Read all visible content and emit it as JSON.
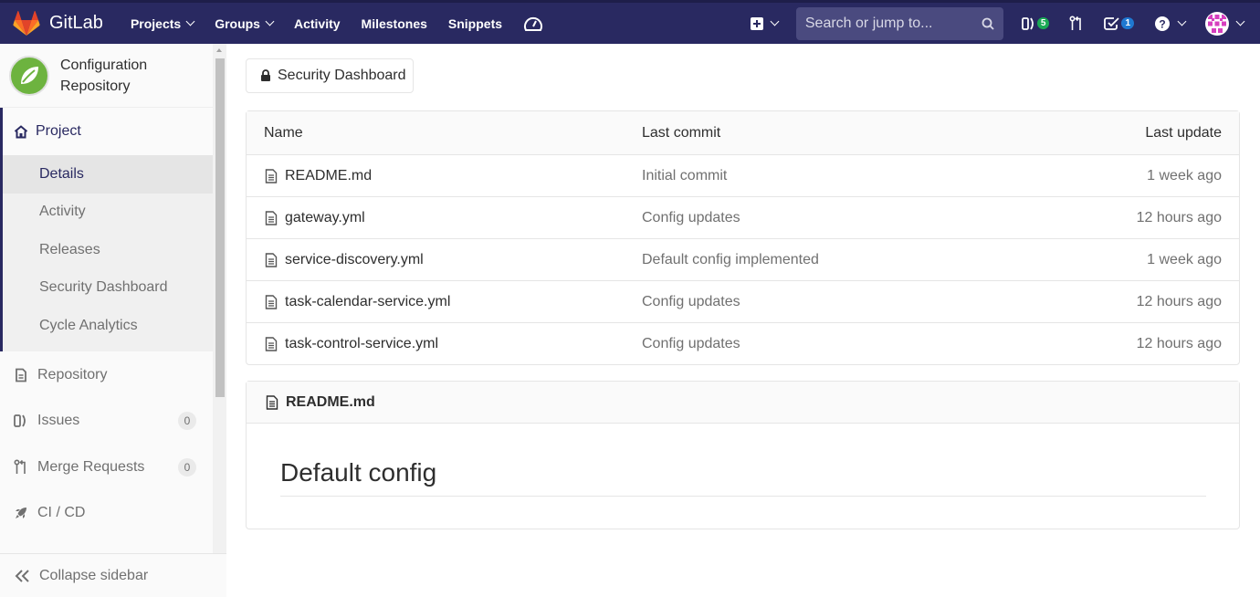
{
  "navbar": {
    "brand": "GitLab",
    "links": [
      "Projects",
      "Groups",
      "Activity",
      "Milestones",
      "Snippets"
    ],
    "search_placeholder": "Search or jump to...",
    "issues_count": "5",
    "todos_count": "1"
  },
  "sidebar": {
    "project_name": "Configuration Repository",
    "project_section": "Project",
    "project_items": [
      "Details",
      "Activity",
      "Releases",
      "Security Dashboard",
      "Cycle Analytics"
    ],
    "repository": "Repository",
    "issues": {
      "label": "Issues",
      "count": "0"
    },
    "merge_requests": {
      "label": "Merge Requests",
      "count": "0"
    },
    "cicd": "CI / CD",
    "collapse": "Collapse sidebar"
  },
  "main": {
    "security_button": "Security Dashboard",
    "table_headers": {
      "name": "Name",
      "last_commit": "Last commit",
      "last_update": "Last update"
    },
    "files": [
      {
        "name": "README.md",
        "commit": "Initial commit",
        "updated": "1 week ago"
      },
      {
        "name": "gateway.yml",
        "commit": "Config updates",
        "updated": "12 hours ago"
      },
      {
        "name": "service-discovery.yml",
        "commit": "Default config implemented",
        "updated": "1 week ago"
      },
      {
        "name": "task-calendar-service.yml",
        "commit": "Config updates",
        "updated": "12 hours ago"
      },
      {
        "name": "task-control-service.yml",
        "commit": "Config updates",
        "updated": "12 hours ago"
      }
    ],
    "readme": {
      "filename": "README.md",
      "heading": "Default config"
    }
  },
  "colors": {
    "navbar": "#292961",
    "accent": "#292961",
    "green_badge": "#1aaa55",
    "blue_badge": "#1f78d1"
  }
}
